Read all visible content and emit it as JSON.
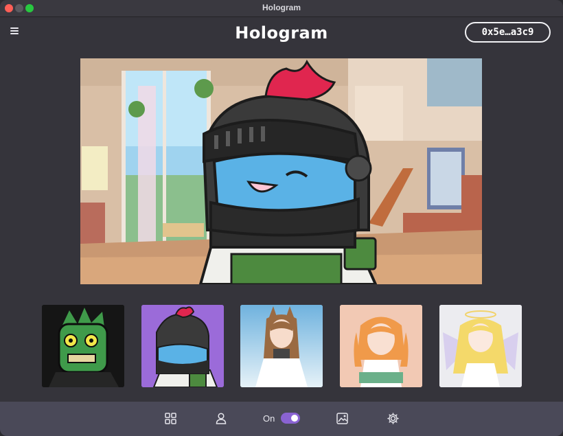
{
  "window": {
    "title": "Hologram"
  },
  "header": {
    "app_title": "Hologram",
    "wallet_label": "0x5e…a3c9",
    "menu_icon": "hamburger-menu-icon"
  },
  "preview": {
    "description_icon": "knight-cat-avatar-over-room-background"
  },
  "avatars": [
    {
      "name": "zombie",
      "icon": "zombie-avatar"
    },
    {
      "name": "knight-cat",
      "icon": "knight-cat-avatar",
      "selected": true
    },
    {
      "name": "fox-girl",
      "icon": "fox-girl-avatar"
    },
    {
      "name": "orange-hair-girl",
      "icon": "orange-hair-girl-avatar"
    },
    {
      "name": "angel-girl",
      "icon": "angel-girl-avatar"
    }
  ],
  "bottom_bar": {
    "toggle_label": "On",
    "toggle_on": true,
    "icons": [
      "grid-icon",
      "user-icon",
      "toggle",
      "image-icon",
      "gear-icon"
    ]
  },
  "colors": {
    "background": "#35343b",
    "bottom_bar": "#4a4958",
    "accent": "#8a63d2"
  }
}
